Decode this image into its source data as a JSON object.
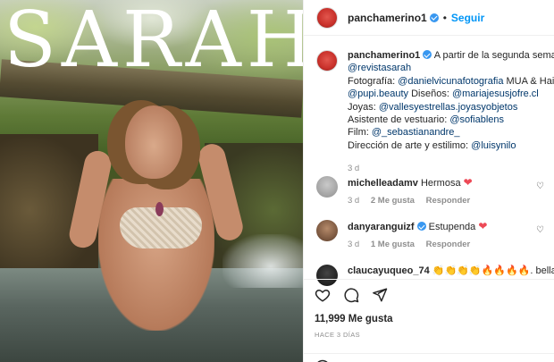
{
  "photo": {
    "magazine_title": "SARAH"
  },
  "header": {
    "username": "panchamerino1",
    "separator": "•",
    "follow_label": "Seguir"
  },
  "caption": {
    "username": "panchamerino1",
    "text_line1": "A partir de la segunda semana de fe",
    "mention_magazine": "@revistasarah",
    "photo_label": "Fotografía: ",
    "mention_photo": "@danielvicunafotografia",
    "mua_label": " MUA & Hairstyle:",
    "mention_mua": "@pupi.beauty",
    "design_label": " Diseños: ",
    "mention_design": "@mariajesusjofre.cl",
    "jewelry_label": "Joyas: ",
    "mention_jewelry": "@vallesyestrellas.joyasyobjetos",
    "wardrobe_label": "Asistente de vestuario: ",
    "mention_wardrobe": "@sofiablens",
    "film_label": "Film: ",
    "mention_film": "@_sebastianandre_",
    "direction_label": "Dirección de arte y estilimo: ",
    "mention_direction": "@luisynilo",
    "age": "3 d"
  },
  "comments": [
    {
      "username": "michelleadamv",
      "verified": false,
      "text": "Hermosa",
      "emoji": "❤",
      "age": "3 d",
      "likes": "2 Me gusta",
      "reply": "Responder"
    },
    {
      "username": "danyaranguizf",
      "verified": true,
      "text": "Estupenda",
      "emoji": "❤",
      "age": "3 d",
      "likes": "1 Me gusta",
      "reply": "Responder"
    },
    {
      "username": "claucayuqueo_74",
      "verified": false,
      "text": "👏👏👏👏🔥🔥🔥🔥. bella!!!!!"
    }
  ],
  "actions": {
    "like_icon": "heart-icon",
    "comment_icon": "comment-icon",
    "share_icon": "send-icon",
    "likes_count": "11,999 Me gusta",
    "time_ago": "HACE 3 DÍAS"
  },
  "colors": {
    "follow_blue": "#0095f6",
    "link_blue": "#00376b",
    "heart_red": "#ed4956",
    "verified_blue": "#3897f0"
  }
}
